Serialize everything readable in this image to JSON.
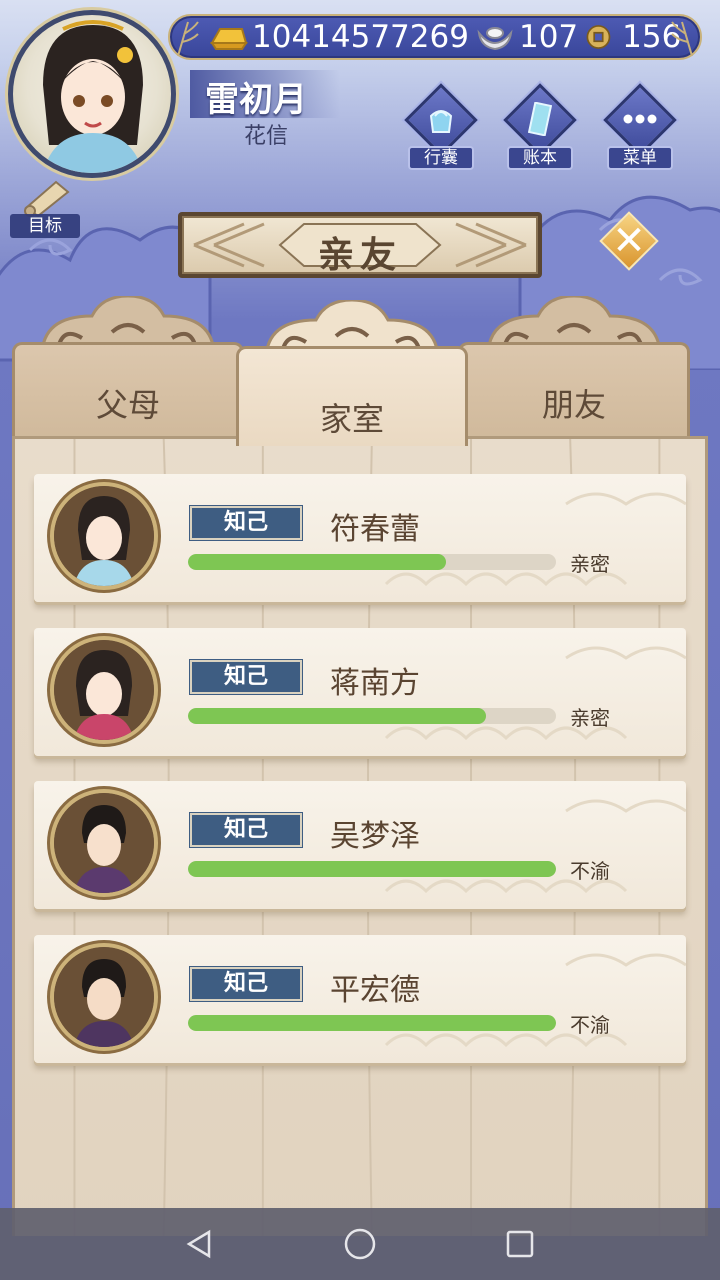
{
  "currency": {
    "gold": "10414577269",
    "silver": "107",
    "coin": "156"
  },
  "player": {
    "name": "雷初月",
    "title": "花信"
  },
  "menu": [
    {
      "label": "行囊",
      "icon": "bag-icon"
    },
    {
      "label": "账本",
      "icon": "ledger-icon"
    },
    {
      "label": "菜单",
      "icon": "more-icon"
    }
  ],
  "goal_label": "目标",
  "title": "亲友",
  "tabs": [
    {
      "label": "父母",
      "active": false
    },
    {
      "label": "家室",
      "active": true
    },
    {
      "label": "朋友",
      "active": false
    }
  ],
  "relations": [
    {
      "badge": "知己",
      "name": "符春蕾",
      "status": "亲密",
      "progress": 0.7
    },
    {
      "badge": "知己",
      "name": "蒋南方",
      "status": "亲密",
      "progress": 0.81
    },
    {
      "badge": "知己",
      "name": "吴梦泽",
      "status": "不渝",
      "progress": 1.0
    },
    {
      "badge": "知己",
      "name": "平宏德",
      "status": "不渝",
      "progress": 1.0
    }
  ],
  "colors": {
    "progress_fill": "#7ec653",
    "badge_bg": "#3e5d82",
    "panel_bg": "#e8dccb"
  }
}
